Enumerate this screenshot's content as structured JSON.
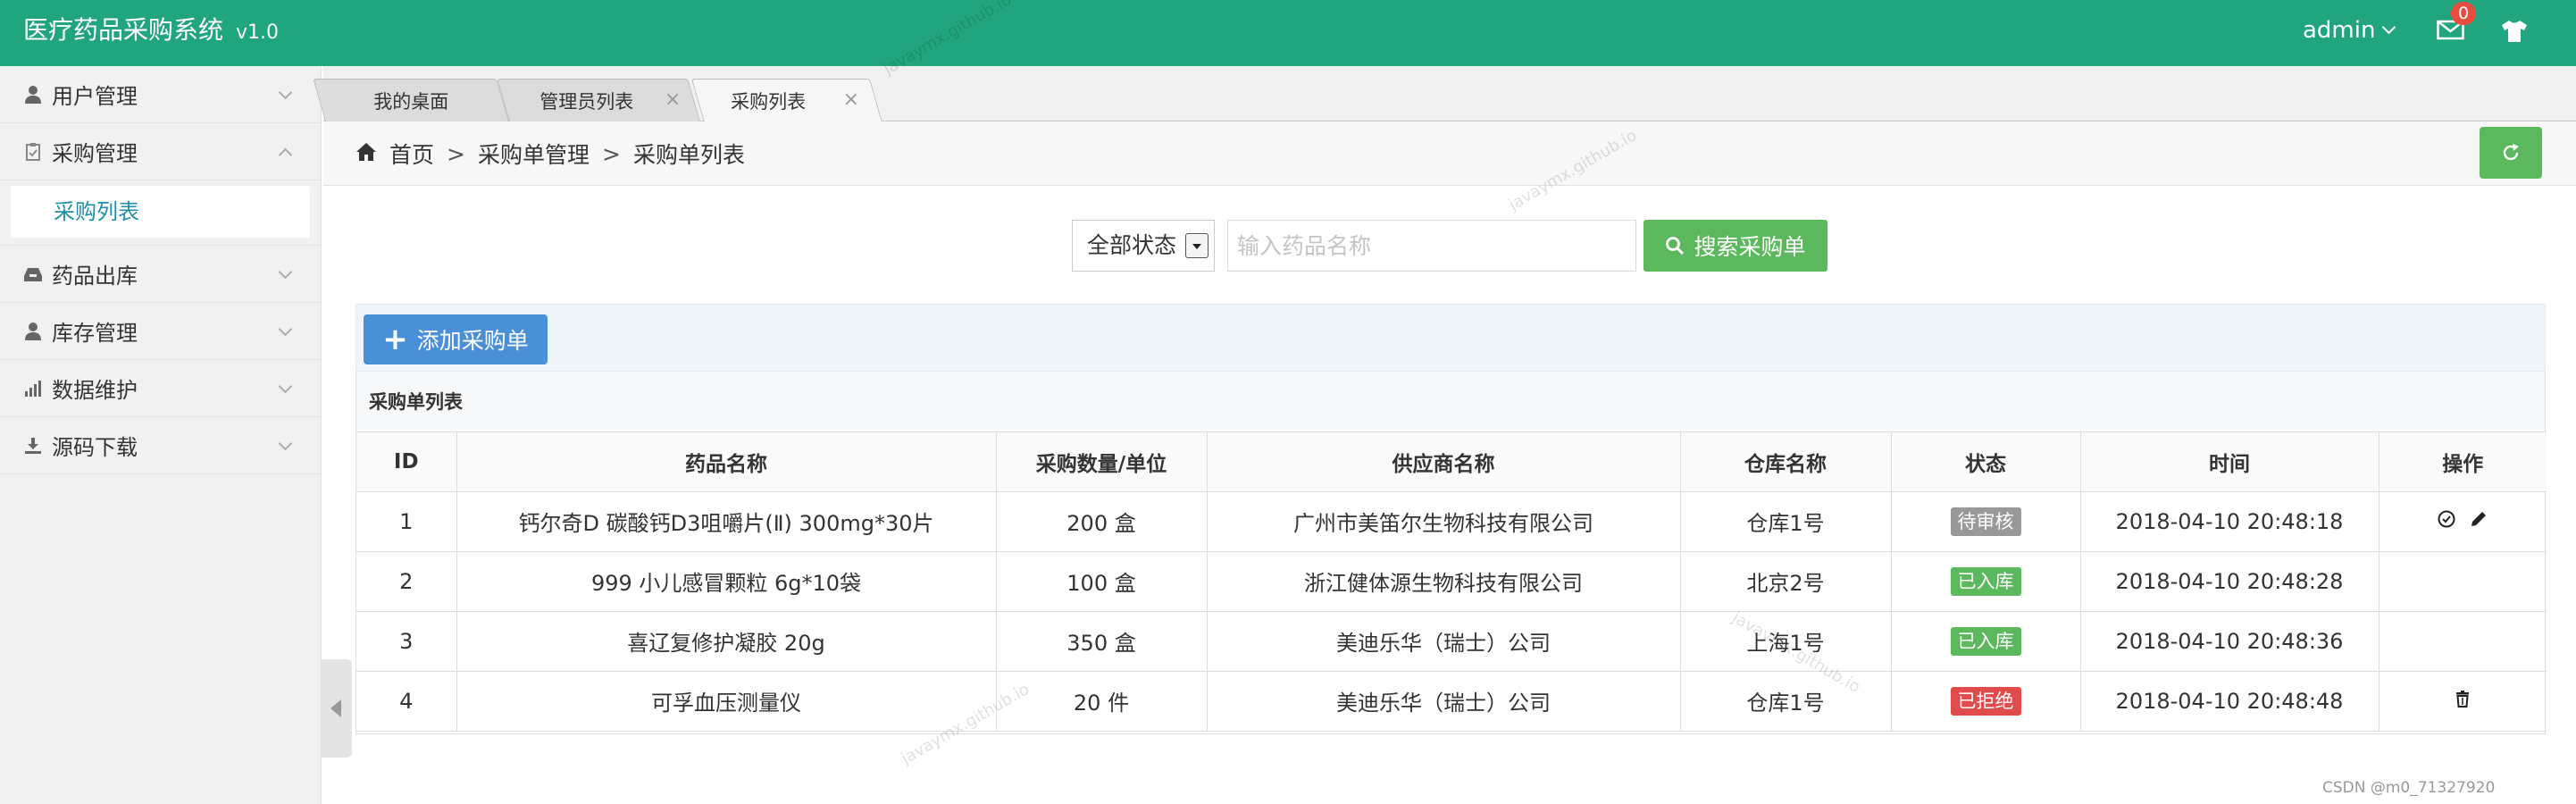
{
  "header": {
    "title": "医疗药品采购系统",
    "version": "v1.0",
    "user": "admin",
    "mail_count": "0",
    "bg_color": "#20a57e"
  },
  "sidebar": {
    "groups": [
      {
        "label": "用户管理",
        "icon": "user-icon",
        "expanded": false
      },
      {
        "label": "采购管理",
        "icon": "clipboard-icon",
        "expanded": true,
        "children": [
          "采购列表"
        ]
      },
      {
        "label": "药品出库",
        "icon": "inbox-icon",
        "expanded": false
      },
      {
        "label": "库存管理",
        "icon": "user-icon",
        "expanded": false
      },
      {
        "label": "数据维护",
        "icon": "bar-chart-icon",
        "expanded": false
      },
      {
        "label": "源码下载",
        "icon": "download-icon",
        "expanded": false
      }
    ]
  },
  "tabs": [
    {
      "label": "我的桌面",
      "closable": false,
      "active": false
    },
    {
      "label": "管理员列表",
      "closable": true,
      "active": false
    },
    {
      "label": "采购列表",
      "closable": true,
      "active": true
    }
  ],
  "breadcrumb": [
    "首页",
    "采购单管理",
    "采购单列表"
  ],
  "breadcrumb_sep": ">",
  "search": {
    "status_selected": "全部状态",
    "placeholder": "输入药品名称",
    "button_label": "搜索采购单"
  },
  "toolbar": {
    "add_label": "添加采购单"
  },
  "panel": {
    "title": "采购单列表"
  },
  "table": {
    "columns": [
      "ID",
      "药品名称",
      "采购数量/单位",
      "供应商名称",
      "仓库名称",
      "状态",
      "时间",
      "操作"
    ],
    "rows": [
      {
        "id": "1",
        "name": "钙尔奇D 碳酸钙D3咀嚼片(Ⅱ) 300mg*30片",
        "qty": "200 盒",
        "supplier": "广州市美笛尔生物科技有限公司",
        "warehouse": "仓库1号",
        "status": "待审核",
        "status_color": "#999999",
        "time": "2018-04-10 20:48:18",
        "ops": [
          "check-circle-icon",
          "pencil-icon"
        ]
      },
      {
        "id": "2",
        "name": "999 小儿感冒颗粒 6g*10袋",
        "qty": "100 盒",
        "supplier": "浙江健体源生物科技有限公司",
        "warehouse": "北京2号",
        "status": "已入库",
        "status_color": "#5cb85c",
        "time": "2018-04-10 20:48:28",
        "ops": []
      },
      {
        "id": "3",
        "name": "喜辽复修护凝胶 20g",
        "qty": "350 盒",
        "supplier": "美迪乐华（瑞士）公司",
        "warehouse": "上海1号",
        "status": "已入库",
        "status_color": "#5cb85c",
        "time": "2018-04-10 20:48:36",
        "ops": []
      },
      {
        "id": "4",
        "name": "可孚血压测量仪",
        "qty": "20 件",
        "supplier": "美迪乐华（瑞士）公司",
        "warehouse": "仓库1号",
        "status": "已拒绝",
        "status_color": "#e04b4b",
        "time": "2018-04-10 20:48:48",
        "ops": [
          "trash-icon"
        ]
      }
    ]
  },
  "watermark": "javaymx.github.io",
  "footer_credit": "CSDN @m0_71327920"
}
